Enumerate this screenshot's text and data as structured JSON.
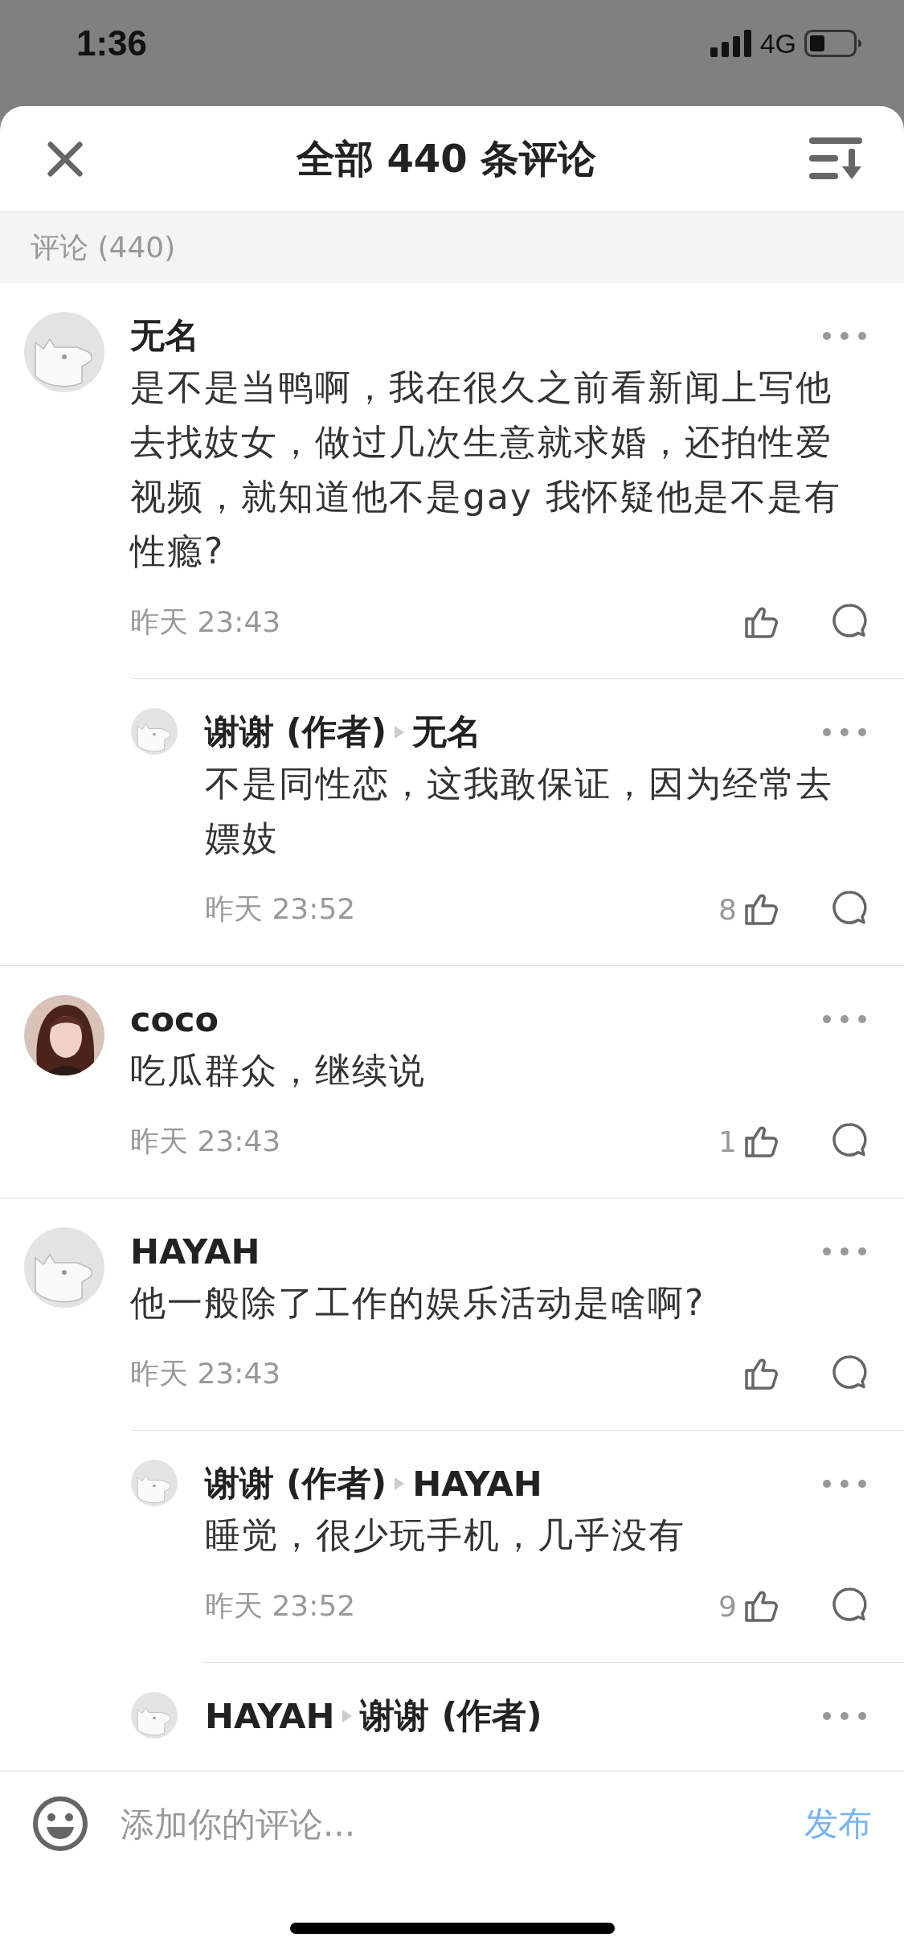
{
  "status_bar": {
    "time": "1:36",
    "network": "4G"
  },
  "header": {
    "title": "全部 440 条评论"
  },
  "section": {
    "label": "评论 (440)"
  },
  "comments": [
    {
      "name": "无名",
      "kind": "default",
      "text": "是不是当鸭啊，我在很久之前看新闻上写他去找妓女，做过几次生意就求婚，还拍性爱视频，就知道他不是gay  我怀疑他是不是有性瘾?",
      "time": "昨天 23:43",
      "replies": [
        {
          "from": "谢谢 (作者)",
          "to": "无名",
          "text": "不是同性恋，这我敢保证，因为经常去嫖妓",
          "time": "昨天 23:52",
          "likes": "8"
        }
      ]
    },
    {
      "name": "coco",
      "text": "吃瓜群众，继续说",
      "time": "昨天 23:43",
      "likes": "1"
    },
    {
      "name": "HAYAH",
      "kind": "default",
      "text": "他一般除了工作的娱乐活动是啥啊?",
      "time": "昨天 23:43",
      "replies": [
        {
          "from": "谢谢 (作者)",
          "to": "HAYAH",
          "text": "睡觉，很少玩手机，几乎没有",
          "time": "昨天 23:52",
          "likes": "9"
        },
        {
          "from": "HAYAH",
          "to": "谢谢 (作者)"
        }
      ]
    }
  ],
  "composer": {
    "placeholder": "添加你的评论...",
    "submit": "发布"
  }
}
